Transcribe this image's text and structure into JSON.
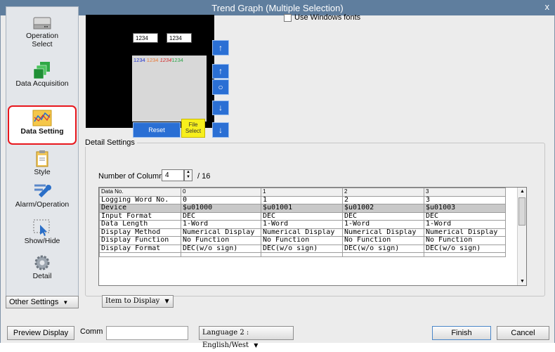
{
  "window": {
    "title": "Trend Graph (Multiple Selection)",
    "close_glyph": "x"
  },
  "sidebar": {
    "items": [
      {
        "label": "Operation\nSelect",
        "icon": "hard-drive-icon",
        "active": false
      },
      {
        "label": "Data Acquisition",
        "icon": "stacked-squares-icon",
        "active": false
      },
      {
        "label": "Data Setting",
        "icon": "trend-graph-icon",
        "active": true
      },
      {
        "label": "Style",
        "icon": "clipboard-icon",
        "active": false
      },
      {
        "label": "Alarm/Operation",
        "icon": "wrench-icon",
        "active": false
      },
      {
        "label": "Show/Hide",
        "icon": "cursor-select-icon",
        "active": false
      },
      {
        "label": "Detail",
        "icon": "gear-icon",
        "active": false
      }
    ],
    "other_settings": "Other Settings"
  },
  "preview": {
    "num1": "1234",
    "num2": "1234",
    "legend": [
      {
        "text": "1234",
        "color": "#2233cc"
      },
      {
        "text": "1234",
        "color": "#e87a3a"
      },
      {
        "text": "1234",
        "color": "#d22c2c"
      },
      {
        "text": "1234",
        "color": "#2ea44a"
      }
    ],
    "reset_label": "Reset",
    "file_label_line1": "File",
    "file_label_line2": "Select"
  },
  "options": {
    "use_windows_fonts": "Use Windows fonts"
  },
  "detail": {
    "title": "Detail Settings",
    "columns_label": "Number of Columns",
    "columns_value": "4",
    "columns_max": "/ 16",
    "table": {
      "header": [
        "Data No.",
        "0",
        "1",
        "2",
        "3"
      ],
      "rows": [
        [
          "Logging Word No.",
          "0",
          "1",
          "2",
          "3"
        ],
        [
          "Device",
          "$u01000",
          "$u01001",
          "$u01002",
          "$u01003"
        ],
        [
          "Input Format",
          "DEC",
          "DEC",
          "DEC",
          "DEC"
        ],
        [
          "Data Length",
          "1-Word",
          "1-Word",
          "1-Word",
          "1-Word"
        ],
        [
          "Display Method",
          "Numerical Display",
          "Numerical Display",
          "Numerical Display",
          "Numerical Display"
        ],
        [
          "Display Function",
          "No Function",
          "No Function",
          "No Function",
          "No Function"
        ],
        [
          "Display Format",
          "DEC(w/o sign)",
          "DEC(w/o sign)",
          "DEC(w/o sign)",
          "DEC(w/o sign)"
        ]
      ],
      "selected_row": 1
    },
    "item_to_display": "Item to Display"
  },
  "footer": {
    "preview_display": "Preview Display",
    "comm_label": "Comm",
    "comm_value": "",
    "language": "Language 2 : English/West",
    "finish": "Finish",
    "cancel": "Cancel"
  }
}
